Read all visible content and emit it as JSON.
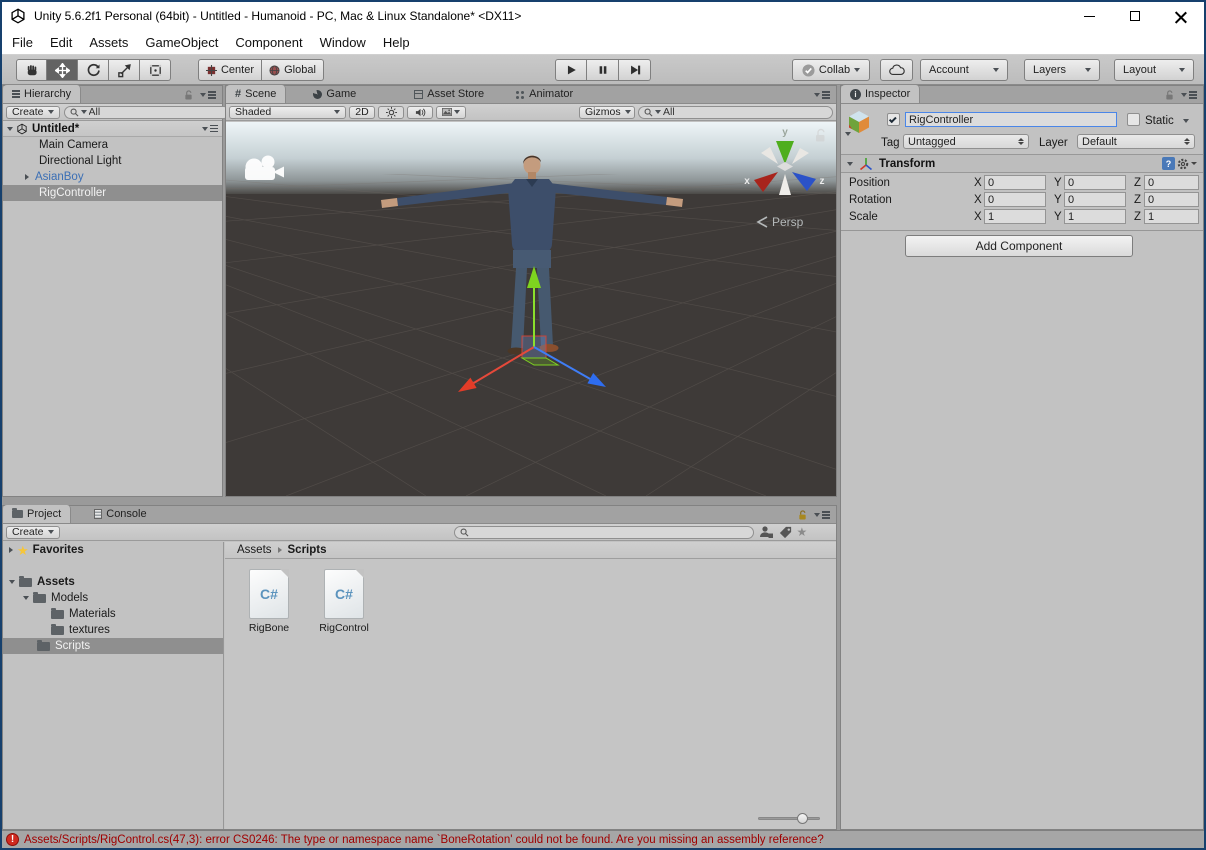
{
  "window": {
    "title": "Unity 5.6.2f1 Personal (64bit) - Untitled - Humanoid - PC, Mac & Linux Standalone* <DX11>"
  },
  "menu": {
    "items": [
      "File",
      "Edit",
      "Assets",
      "GameObject",
      "Component",
      "Window",
      "Help"
    ]
  },
  "toolbar": {
    "center_label": "Center",
    "global_label": "Global",
    "collab_label": "Collab",
    "account_label": "Account",
    "layers_label": "Layers",
    "layout_label": "Layout"
  },
  "hierarchy": {
    "tab_label": "Hierarchy",
    "create_label": "Create",
    "search_text": "All",
    "scene_name": "Untitled*",
    "items": [
      {
        "label": "Main Camera"
      },
      {
        "label": "Directional Light"
      },
      {
        "label": "AsianBoy"
      },
      {
        "label": "RigController"
      }
    ]
  },
  "scene": {
    "tabs": {
      "scene": "Scene",
      "game": "Game",
      "asset_store": "Asset Store",
      "animator": "Animator"
    },
    "shading_mode": "Shaded",
    "toggle_2d": "2D",
    "gizmos_label": "Gizmos",
    "search_text": "All",
    "persp_label": "Persp",
    "gizmo_axes": {
      "x": "x",
      "y": "y",
      "z": "z"
    }
  },
  "inspector": {
    "tab_label": "Inspector",
    "object_name": "RigController",
    "static_label": "Static",
    "tag_label": "Tag",
    "tag_value": "Untagged",
    "layer_label": "Layer",
    "layer_value": "Default",
    "transform": {
      "title": "Transform",
      "axis_x": "X",
      "axis_y": "Y",
      "axis_z": "Z",
      "position": {
        "label": "Position",
        "x": "0",
        "y": "0",
        "z": "0"
      },
      "rotation": {
        "label": "Rotation",
        "x": "0",
        "y": "0",
        "z": "0"
      },
      "scale": {
        "label": "Scale",
        "x": "1",
        "y": "1",
        "z": "1"
      }
    },
    "add_component_label": "Add Component"
  },
  "project": {
    "tab_label": "Project",
    "console_tab_label": "Console",
    "create_label": "Create",
    "favorites_label": "Favorites",
    "folders": {
      "assets": "Assets",
      "models": "Models",
      "materials": "Materials",
      "textures": "textures",
      "scripts": "Scripts"
    },
    "breadcrumb": {
      "root": "Assets",
      "current": "Scripts"
    },
    "files": [
      {
        "name": "RigBone",
        "type": "C#"
      },
      {
        "name": "RigControl",
        "type": "C#"
      }
    ]
  },
  "status_bar": {
    "error_message": "Assets/Scripts/RigControl.cs(47,3): error CS0246: The type or namespace name `BoneRotation' could not be found. Are you missing an assembly reference?"
  }
}
